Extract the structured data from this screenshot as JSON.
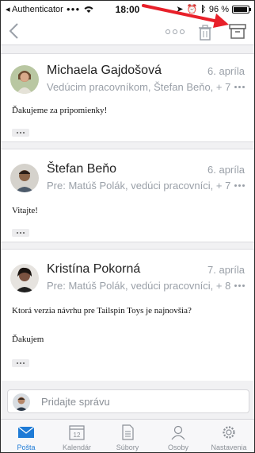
{
  "status_bar": {
    "back_app": "Authenticator",
    "time": "18:00",
    "battery_percent": "96 %",
    "battery_level": 0.96
  },
  "messages": [
    {
      "sender": "Michaela Gajdošová",
      "date": "6. apríla",
      "recipients": "Vedúcim pracovníkom, Štefan Beňo, + 7",
      "body": [
        "Ďakujeme za pripomienky!"
      ]
    },
    {
      "sender": "Štefan Beňo",
      "date": "6. apríla",
      "recipients": "Pre: Matúš Polák, vedúci pracovníci, + 7",
      "body": [
        "Vitajte!"
      ]
    },
    {
      "sender": "Kristína Pokorná",
      "date": "7. apríla",
      "recipients": "Pre: Matúš Polák, vedúci pracovníci, + 8",
      "body": [
        "Ktorá verzia návrhu pre Tailspin Toys je najnovšia?",
        "Ďakujem"
      ]
    }
  ],
  "reply": {
    "placeholder": "Pridajte správu"
  },
  "tabs": [
    {
      "label": "Pošta",
      "icon": "mail-icon",
      "active": true
    },
    {
      "label": "Kalendár",
      "icon": "calendar-icon",
      "active": false,
      "day": "12"
    },
    {
      "label": "Súbory",
      "icon": "files-icon",
      "active": false
    },
    {
      "label": "Osoby",
      "icon": "people-icon",
      "active": false
    },
    {
      "label": "Nastavenia",
      "icon": "settings-icon",
      "active": false
    }
  ],
  "colors": {
    "accent": "#1f7bd6",
    "annotation_arrow": "#e8202a",
    "muted_text": "#9aa0a8"
  }
}
